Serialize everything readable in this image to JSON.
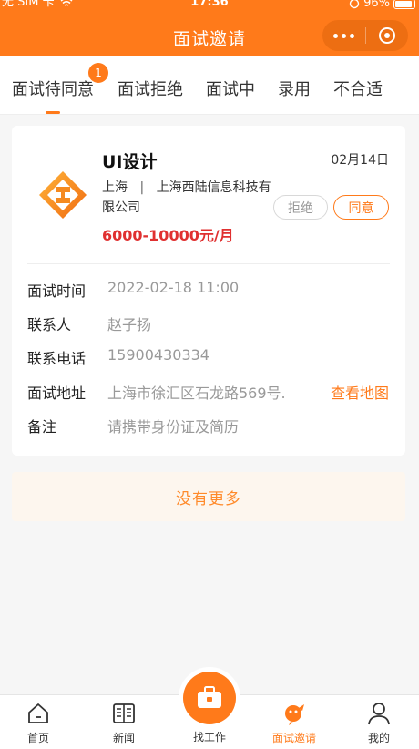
{
  "status_bar": {
    "carrier": "无 SIM 卡",
    "time": "17:36",
    "battery": "96%"
  },
  "nav": {
    "title": "面试邀请"
  },
  "tabs": [
    {
      "label": "面试待同意",
      "badge": "1"
    },
    {
      "label": "面试拒绝"
    },
    {
      "label": "面试中"
    },
    {
      "label": "录用"
    },
    {
      "label": "不合适"
    }
  ],
  "card": {
    "title": "UI设计",
    "date": "02月14日",
    "location": "上海",
    "separator": "|",
    "company": "上海西陆信息科技有限公司",
    "salary": "6000-10000元/月",
    "reject_label": "拒绝",
    "accept_label": "同意",
    "details": [
      {
        "label": "面试时间",
        "value": "2022-02-18 11:00"
      },
      {
        "label": "联系人",
        "value": "赵子扬"
      },
      {
        "label": "联系电话",
        "value": "15900430334"
      },
      {
        "label": "面试地址",
        "value": "上海市徐汇区石龙路569号."
      },
      {
        "label": "备注",
        "value": "请携带身份证及简历"
      }
    ],
    "map_link": "查看地图"
  },
  "no_more": "没有更多",
  "tabbar": [
    {
      "label": "首页",
      "icon": "home-icon"
    },
    {
      "label": "新闻",
      "icon": "news-icon"
    },
    {
      "label": "找工作",
      "icon": "briefcase-icon"
    },
    {
      "label": "面试邀请",
      "icon": "interview-icon",
      "active": true
    },
    {
      "label": "我的",
      "icon": "user-icon"
    }
  ],
  "colors": {
    "accent": "#ff7a1a",
    "salary": "#e03030"
  }
}
